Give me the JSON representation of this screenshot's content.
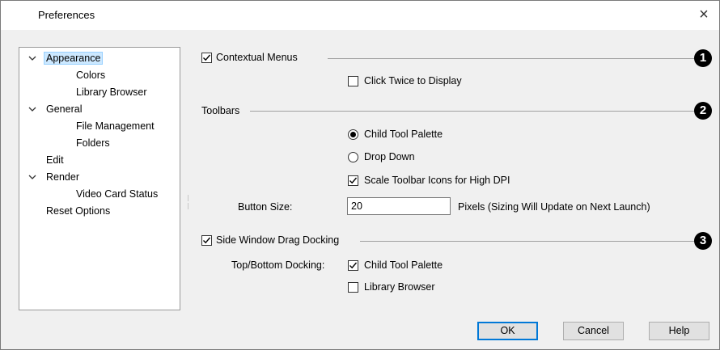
{
  "dialog": {
    "title": "Preferences",
    "close_glyph": "×"
  },
  "tree": {
    "items": [
      {
        "label": "Appearance",
        "expanded": true,
        "selected": true
      },
      {
        "label": "Colors"
      },
      {
        "label": "Library Browser"
      },
      {
        "label": "General",
        "expanded": true
      },
      {
        "label": "File Management"
      },
      {
        "label": "Folders"
      },
      {
        "label": "Edit"
      },
      {
        "label": "Render",
        "expanded": true
      },
      {
        "label": "Video Card Status"
      },
      {
        "label": "Reset Options"
      }
    ]
  },
  "contextual": {
    "label": "Contextual Menus",
    "checked": true,
    "click_twice_label": "Click Twice to Display",
    "click_twice_checked": false,
    "callout": "1"
  },
  "toolbars": {
    "heading": "Toolbars",
    "callout": "2",
    "child_palette_label": "Child Tool Palette",
    "child_palette_selected": true,
    "drop_down_label": "Drop Down",
    "scale_label": "Scale Toolbar Icons for High DPI",
    "scale_checked": true,
    "button_size_label": "Button Size:",
    "button_size_value": "20",
    "button_size_note": "Pixels (Sizing Will Update on Next Launch)"
  },
  "docking": {
    "label": "Side Window Drag Docking",
    "checked": true,
    "callout": "3",
    "top_bottom_label": "Top/Bottom Docking:",
    "child_palette_label": "Child Tool Palette",
    "child_palette_checked": true,
    "library_browser_label": "Library Browser",
    "library_browser_checked": false
  },
  "buttons": {
    "ok": "OK",
    "cancel": "Cancel",
    "help": "Help"
  }
}
